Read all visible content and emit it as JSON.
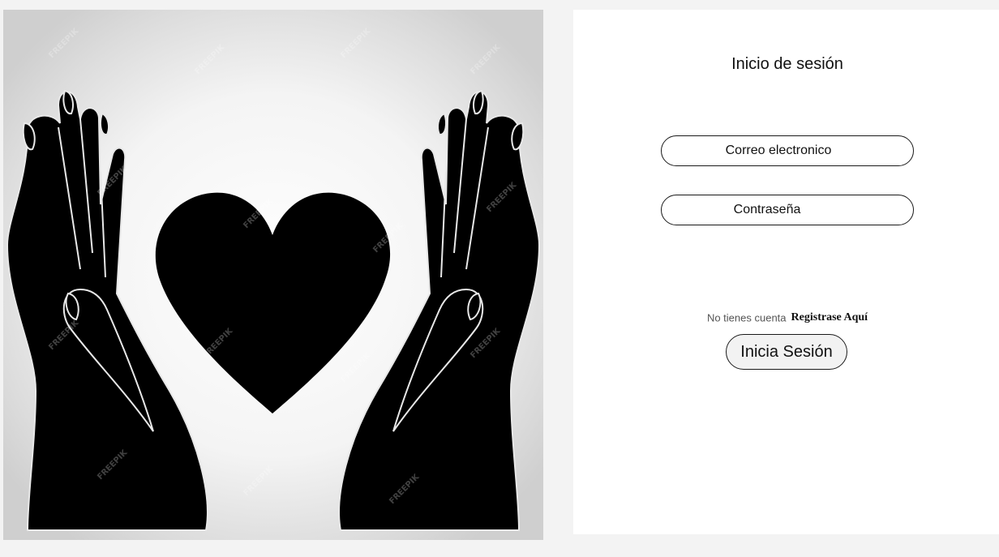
{
  "hero": {
    "icon": "hands-holding-heart-image",
    "watermark": "FREEPIK"
  },
  "login": {
    "title": "Inicio de sesión",
    "email_placeholder": "Correo electronico",
    "password_placeholder": "Contraseña",
    "no_account_text": "No tienes cuenta",
    "register_link": "Registrase Aquí",
    "submit_label": "Inicia Sesión"
  },
  "colors": {
    "page_background": "#f3f3f3",
    "panel_background": "#ffffff",
    "border": "#1a1a1a",
    "button_background": "#f2f2f2"
  }
}
